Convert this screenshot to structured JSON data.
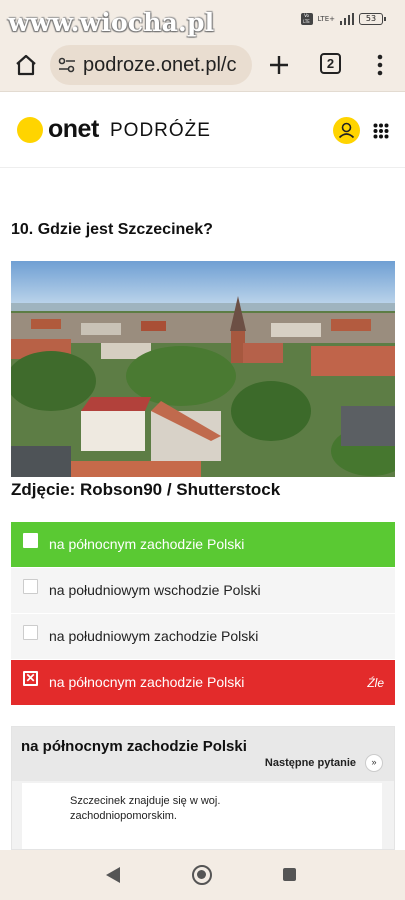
{
  "status_bar": {
    "watermark": "www.wiocha.pl",
    "network_badge": "VoLTE",
    "network_type": "LTE+",
    "battery": "53"
  },
  "browser": {
    "url": "podroze.onet.pl/c",
    "tab_count": "2"
  },
  "header": {
    "logo_text": "onet",
    "section": "PODRÓŻE"
  },
  "quiz": {
    "question": "10. Gdzie jest Szczecinek?",
    "photo_caption": "Zdjęcie: Robson90 / Shutterstock",
    "answers": [
      {
        "label": "na północnym zachodzie Polski",
        "state": "correct"
      },
      {
        "label": "na południowym wschodzie Polski",
        "state": "neutral"
      },
      {
        "label": "na południowym zachodzie Polski",
        "state": "neutral"
      },
      {
        "label": "na północnym zachodzie Polski",
        "state": "wrong",
        "verdict": "Źle"
      }
    ],
    "result": {
      "title": "na północnym zachodzie Polski",
      "next_label": "Następne pytanie",
      "explanation": "Szczecinek znajduje się w woj. zachodniopomorskim."
    }
  },
  "colors": {
    "correct": "#5ac933",
    "wrong": "#e32b2b",
    "brand_yellow": "#ffd400",
    "browser_chrome": "#f3ece4"
  },
  "icons": [
    "home-icon",
    "site-settings-icon",
    "plus-icon",
    "tabs-icon",
    "more-vert-icon",
    "user-icon",
    "apps-grid-icon",
    "chevron-down-icon",
    "nav-back-icon",
    "nav-home-icon",
    "nav-recent-icon"
  ]
}
